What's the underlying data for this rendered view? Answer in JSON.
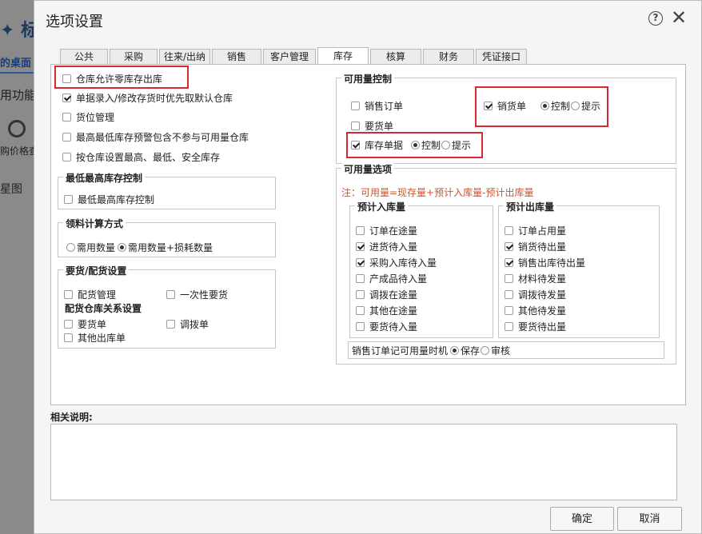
{
  "background_app": {
    "title_fragment": "标",
    "desktop_tab": "的桌面",
    "function_label": "用功能",
    "price_label": "购价格查",
    "chart_label": "星图"
  },
  "dialog": {
    "title": "选项设置",
    "help": "?",
    "close": "✕",
    "tabs": [
      {
        "label": "公共",
        "active": false
      },
      {
        "label": "采购",
        "active": false
      },
      {
        "label": "往来/出纳",
        "active": false
      },
      {
        "label": "销售",
        "active": false
      },
      {
        "label": "客户管理",
        "active": false
      },
      {
        "label": "库存",
        "active": true
      },
      {
        "label": "核算",
        "active": false
      },
      {
        "label": "财务",
        "active": false
      },
      {
        "label": "凭证接口",
        "active": false
      }
    ],
    "left": {
      "options": [
        {
          "label": "仓库允许零库存出库",
          "checked": false
        },
        {
          "label": "单据录入/修改存货时优先取默认仓库",
          "checked": true
        },
        {
          "label": "货位管理",
          "checked": false
        },
        {
          "label": "最高最低库存预警包含不参与可用量仓库",
          "checked": false
        },
        {
          "label": "按仓库设置最高、最低、安全库存",
          "checked": false
        }
      ],
      "max_min_group": {
        "title": "最低最高库存控制",
        "option": {
          "label": "最低最高库存控制",
          "checked": false
        }
      },
      "material_group": {
        "title": "领料计算方式",
        "options": [
          {
            "label": "需用数量",
            "checked": false
          },
          {
            "label": "需用数量+损耗数量",
            "checked": true
          }
        ]
      },
      "requisition_group": {
        "title": "要货/配货设置",
        "distribution": {
          "label": "配货管理",
          "checked": false
        },
        "one_time": {
          "label": "一次性要货",
          "checked": false
        },
        "relation_title": "配货仓库关系设置",
        "requisition": {
          "label": "要货单",
          "checked": false
        },
        "transfer": {
          "label": "调拨单",
          "checked": false
        },
        "other_out": {
          "label": "其他出库单",
          "checked": false
        }
      }
    },
    "right": {
      "control_group": {
        "title": "可用量控制",
        "sales_order": {
          "label": "销售订单",
          "checked": false
        },
        "requisition": {
          "label": "要货单",
          "checked": false
        },
        "delivery": {
          "label": "销货单",
          "checked": true
        },
        "delivery_control": {
          "label": "控制",
          "checked": true
        },
        "delivery_prompt": {
          "label": "提示",
          "checked": false
        },
        "stock_doc": {
          "label": "库存单据",
          "checked": true
        },
        "stock_control": {
          "label": "控制",
          "checked": true
        },
        "stock_prompt": {
          "label": "提示",
          "checked": false
        }
      },
      "options_group": {
        "title": "可用量选项",
        "note": "注：可用量=现存量+预计入库量-预计出库量",
        "inbound": {
          "title": "预计入库量",
          "items": [
            {
              "label": "订单在途量",
              "checked": false
            },
            {
              "label": "进货待入量",
              "checked": true
            },
            {
              "label": "采购入库待入量",
              "checked": true
            },
            {
              "label": "产成品待入量",
              "checked": false
            },
            {
              "label": "调拨在途量",
              "checked": false
            },
            {
              "label": "其他在途量",
              "checked": false
            },
            {
              "label": "要货待入量",
              "checked": false
            }
          ]
        },
        "outbound": {
          "title": "预计出库量",
          "items": [
            {
              "label": "订单占用量",
              "checked": false
            },
            {
              "label": "销货待出量",
              "checked": true
            },
            {
              "label": "销售出库待出量",
              "checked": true
            },
            {
              "label": "材料待发量",
              "checked": false
            },
            {
              "label": "调拨待发量",
              "checked": false
            },
            {
              "label": "其他待发量",
              "checked": false
            },
            {
              "label": "要货待出量",
              "checked": false
            }
          ]
        },
        "record_row": {
          "label": "销售订单记可用量时机",
          "save": {
            "label": "保存",
            "checked": true
          },
          "audit": {
            "label": "审核",
            "checked": false
          }
        }
      }
    },
    "description_label": "相关说明:",
    "ok_label": "确定",
    "cancel_label": "取消"
  }
}
